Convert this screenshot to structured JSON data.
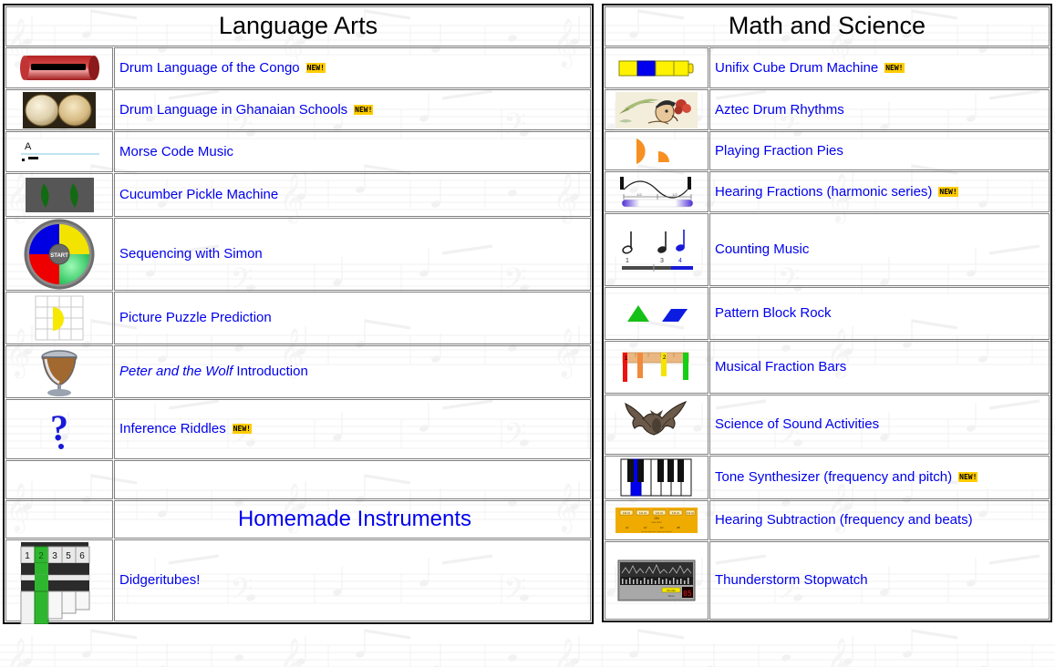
{
  "page": {
    "background": "sheet-music-watermark",
    "link_color": "#0000ee",
    "header_color": "#000000",
    "badge_bg": "#ffcc00"
  },
  "badge": {
    "label": "NEW!"
  },
  "columns": {
    "left": {
      "header": "Language Arts",
      "rows": [
        {
          "icon": "congo-slit-drum-icon",
          "label": "Drum Language of the Congo",
          "new": true
        },
        {
          "icon": "ghanaian-drums-icon",
          "label": "Drum Language in Ghanaian Schools",
          "new": true
        },
        {
          "icon": "morse-code-icon",
          "label": "Morse Code Music",
          "new": false
        },
        {
          "icon": "cucumber-pickle-icon",
          "label": "Cucumber Pickle Machine",
          "new": false
        },
        {
          "icon": "simon-game-icon",
          "label": "Sequencing with Simon",
          "new": false
        },
        {
          "icon": "picture-puzzle-grid-icon",
          "label": "Picture Puzzle Prediction",
          "new": false
        },
        {
          "icon": "timpani-drum-icon",
          "label_italic": "Peter and the Wolf",
          "label_rest": " Introduction",
          "new": false
        },
        {
          "icon": "question-mark-icon",
          "label": "Inference Riddles",
          "new": true
        },
        {
          "icon": "blank-icon",
          "label": "",
          "new": false
        }
      ],
      "sub_header": "Homemade Instruments",
      "sub_rows": [
        {
          "icon": "didgeritubes-icon",
          "label": "Didgeritubes!",
          "new": false
        }
      ]
    },
    "right": {
      "header": "Math and Science",
      "rows": [
        {
          "icon": "unifix-cubes-icon",
          "label": "Unifix Cube Drum Machine",
          "new": true
        },
        {
          "icon": "aztec-figure-icon",
          "label": "Aztec Drum Rhythms",
          "new": false
        },
        {
          "icon": "fraction-pies-icon",
          "label": "Playing Fraction Pies",
          "new": false
        },
        {
          "icon": "harmonic-wave-icon",
          "label": "Hearing Fractions (harmonic series)",
          "new": true
        },
        {
          "icon": "quarter-notes-icon",
          "label": "Counting Music",
          "new": false
        },
        {
          "icon": "pattern-blocks-icon",
          "label": "Pattern Block Rock",
          "new": false
        },
        {
          "icon": "fraction-bars-icon",
          "label": "Musical Fraction Bars",
          "new": false
        },
        {
          "icon": "bat-icon",
          "label": "Science of Sound Activities",
          "new": false
        },
        {
          "icon": "piano-keys-icon",
          "label": "Tone Synthesizer (frequency and pitch)",
          "new": true
        },
        {
          "icon": "frequency-panel-icon",
          "label": "Hearing Subtraction (frequency and beats)",
          "new": false
        },
        {
          "icon": "stopwatch-meter-icon",
          "label": "Thunderstorm Stopwatch",
          "new": false
        }
      ]
    }
  }
}
